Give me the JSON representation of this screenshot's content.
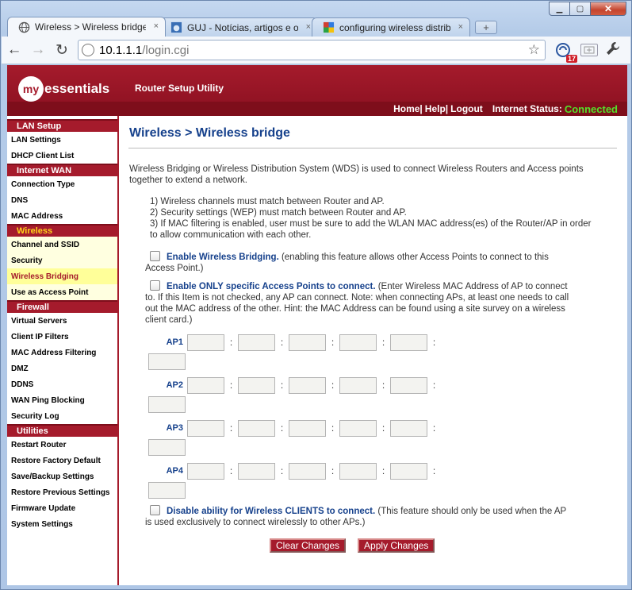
{
  "browser": {
    "tabs": [
      {
        "title": "Wireless > Wireless bridge",
        "icon": "globe-icon",
        "active": true
      },
      {
        "title": "GUJ - Notícias, artigos e o n",
        "icon": "guj-icon",
        "active": false
      },
      {
        "title": "configuring wireless distrib",
        "icon": "google-icon",
        "active": false
      }
    ],
    "url_host": "10.1.1.1",
    "url_path": "/login.cgi",
    "badge_count": "17",
    "minimize": "▁",
    "maximize": "▢",
    "close": "✕",
    "new_tab": "+",
    "tab_close": "×",
    "back": "←",
    "forward": "→",
    "reload": "↻",
    "star": "☆",
    "wrench": "🔧"
  },
  "header": {
    "logo_circle": "my",
    "logo_text": "essentials",
    "utility_title": "Router Setup Utility",
    "links": {
      "home": "Home|",
      "help": "Help|",
      "logout": "Logout"
    },
    "internet_status_label": "Internet Status:",
    "internet_status_value": "Connected"
  },
  "sidebar": {
    "lan": {
      "head": "LAN Setup",
      "items": [
        "LAN Settings",
        "DHCP Client List"
      ]
    },
    "wan": {
      "head": "Internet WAN",
      "items": [
        "Connection Type",
        "DNS",
        "MAC Address"
      ]
    },
    "wireless": {
      "head": "Wireless",
      "items": [
        "Channel and SSID",
        "Security",
        "Wireless Bridging",
        "Use as Access Point"
      ]
    },
    "firewall": {
      "head": "Firewall",
      "items": [
        "Virtual Servers",
        "Client IP Filters",
        "MAC Address Filtering",
        "DMZ",
        "DDNS",
        "WAN Ping Blocking",
        "Security Log"
      ]
    },
    "utilities": {
      "head": "Utilities",
      "items": [
        "Restart Router",
        "Restore Factory Default",
        "Save/Backup Settings",
        "Restore Previous Settings",
        "Firmware Update",
        "System Settings"
      ]
    }
  },
  "content": {
    "title": "Wireless > Wireless bridge",
    "description": "Wireless Bridging or Wireless Distribution System (WDS) is used to connect Wireless Routers and Access points together to extend a network.",
    "rule1": "1) Wireless channels must match between Router and AP.",
    "rule2": "2) Security settings (WEP) must match between Router and AP.",
    "rule3": "3) If MAC filtering is enabled, user must be sure to add the WLAN MAC address(es) of the Router/AP in order to allow communication with each other.",
    "opt1_bold": "Enable Wireless Bridging.",
    "opt1_text": " (enabling this feature allows other Access Points to connect to this Access Point.)",
    "opt2_bold": "Enable ONLY specific Access Points to connect.",
    "opt2_text": " (Enter Wireless MAC Address of AP to connect to. If this Item is not checked, any AP can connect. Note: when connecting APs, at least one needs to call out the MAC address of the other. Hint: the MAC Address can be found using a site survey on a wireless client card.)",
    "ap_labels": [
      "AP1",
      "AP2",
      "AP3",
      "AP4"
    ],
    "colon": ":",
    "opt3_bold": "Disable ability for Wireless CLIENTS to connect.",
    "opt3_text": " (This feature should only be used when the AP is used exclusively to connect wirelessly to other APs.)",
    "clear_button": "Clear Changes",
    "apply_button": "Apply Changes"
  }
}
